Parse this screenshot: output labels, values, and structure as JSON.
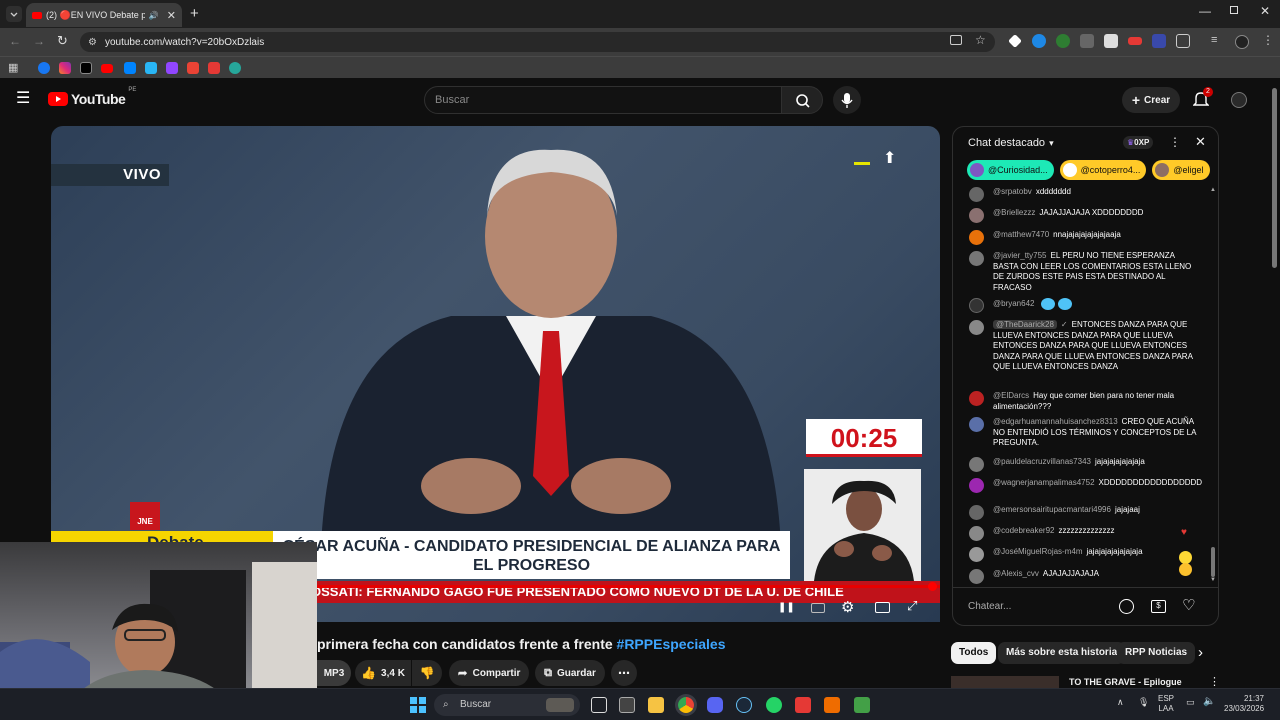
{
  "browser": {
    "tab_title": "(2) 🔴EN VIVO Debate pre",
    "url": "youtube.com/watch?v=20bOxDzlais"
  },
  "youtube": {
    "logo": "YouTube",
    "region": "PE",
    "search_placeholder": "Buscar",
    "create_label": "Crear",
    "notif_count": "2"
  },
  "video": {
    "live_label": "VIVO",
    "timer": "00:25",
    "lower_third": "CÉSAR ACUÑA - CANDIDATO PRESIDENCIAL DE ALIANZA PARA EL PROGRESO",
    "lower_left": "Debate",
    "ticker": "OSSATI: FERNANDO GAGO FUE PRESENTADO COMO NUEVO DT DE LA U. DE CHILE",
    "channel_logo": "JNE",
    "progress": 1.0
  },
  "below": {
    "title_text": "primera fecha con candidatos frente a frente ",
    "title_tag": "#RPPEspeciales",
    "partial_button": "MP3",
    "likes": "3,4 K",
    "share": "Compartir",
    "save": "Guardar"
  },
  "chat": {
    "header": "Chat destacado",
    "xp": "0XP",
    "chips": [
      "@Curiosidad...",
      "@cotoperro4...",
      "@eligel"
    ],
    "messages": [
      {
        "author": "@srpatobv",
        "text": "xddddddd",
        "color": "#666"
      },
      {
        "author": "@Briellezzz",
        "text": "JAJAJJAJAJA XDDDDDDDD",
        "color": "#8a7070"
      },
      {
        "author": "@matthew7470",
        "text": "nnajajajajajajajaaja",
        "color": "#e8710a"
      },
      {
        "author": "@javier_tty755",
        "text": "EL PERU NO TIENE ESPERANZA BASTA CON LEER LOS COMENTARIOS ESTA LLENO DE ZURDOS ESTE PAIS ESTA DESTINADO AL FRACASO",
        "color": "#777"
      },
      {
        "author": "@bryan642",
        "text": "",
        "color": "#333"
      },
      {
        "author": "@TheDaarick28",
        "text": "ENTONCES DANZA PARA QUE LLUEVA ENTONCES DANZA PARA QUE LLUEVA ENTONCES DANZA PARA QUE LLUEVA ENTONCES DANZA PARA QUE LLUEVA ENTONCES DANZA PARA QUE LLUEVA ENTONCES DANZA",
        "color": "#888"
      },
      {
        "author": "@ElDarcs",
        "text": "Hay que comer bien para no tener mala alimentación???",
        "color": "#b22"
      },
      {
        "author": "@edgarhuamannahuisanchez8313",
        "text": "CREO QUE ACUÑA NO ENTENDIÓ LOS TÉRMINOS Y CONCEPTOS DE LA PREGUNTA.",
        "color": "#5a6fa8"
      },
      {
        "author": "@pauldelacruzvillanas7343",
        "text": "jajajajajajajaja",
        "color": "#777"
      },
      {
        "author": "@wagnerjanampalimas4752",
        "text": "XDDDDDDDDDDDDDDDDD",
        "color": "#9c27b0"
      },
      {
        "author": "@emersonsairitupacmantari4996",
        "text": "jajajaaj",
        "color": "#666"
      },
      {
        "author": "@codebreaker92",
        "text": "zzzzzzzzzzzzzz",
        "color": "#888"
      },
      {
        "author": "@JoséMiguelRojas-m4m",
        "text": "jajajajajajajajaja",
        "color": "#999"
      },
      {
        "author": "@Alexis_cvv",
        "text": "AJAJAJJAJAJA",
        "color": "#777"
      }
    ],
    "input_placeholder": "Chatear..."
  },
  "filters": [
    "Todos",
    "Más sobre esta historia",
    "RPP Noticias"
  ],
  "recommendation": "TO THE GRAVE - Epilogue",
  "taskbar": {
    "search": "Buscar",
    "lang": "ESP",
    "lang2": "LAA",
    "time": "21:37",
    "date": "23/03/2026"
  }
}
